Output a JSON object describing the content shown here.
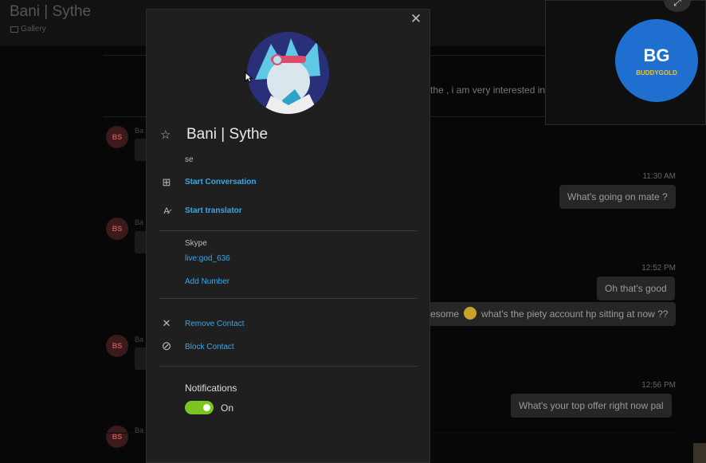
{
  "background": {
    "chat_title": "Bani | Sythe",
    "gallery_label": "Gallery",
    "sender_initials": "BS",
    "sender_name_prefix": "Ba",
    "incoming_fragment": "the , i am very interested in",
    "messages": [
      {
        "time": "11:30 AM",
        "text": "What's going on mate ?"
      },
      {
        "time": "12:52 PM",
        "text": "Oh that's good"
      },
      {
        "time": "",
        "text_before": "esome",
        "text_after": "what's the piety account hp sitting at now ??"
      },
      {
        "time": "12:56 PM",
        "text": "What's your top offer right now pal"
      }
    ]
  },
  "video_overlay": {
    "logo_initials": "BG",
    "logo_name": "BUDDYGOLD"
  },
  "profile": {
    "name": "Bani | Sythe",
    "subtitle": "se",
    "start_conversation": "Start Conversation",
    "start_translator": "Start translator",
    "skype_label": "Skype",
    "skype_id": "live:god_636",
    "add_number": "Add Number",
    "remove_contact": "Remove Contact",
    "block_contact": "Block Contact",
    "notifications_label": "Notifications",
    "notifications_state": "On",
    "notifications_on": true
  },
  "colors": {
    "panel_bg": "#1f1f1f",
    "link": "#37a8e8",
    "toggle_on": "#7cc520",
    "avatar_initials_bg": "#3b1a1c"
  },
  "icons": [
    "star-icon",
    "chat-add-icon",
    "translate-icon",
    "close-icon",
    "block-icon",
    "expand-icon",
    "gallery-icon"
  ]
}
